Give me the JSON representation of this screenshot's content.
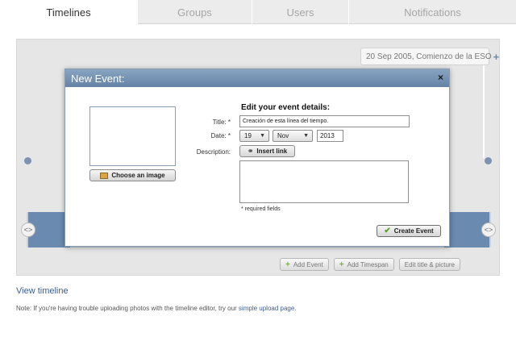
{
  "tabs": [
    {
      "label": "Timelines",
      "active": true
    },
    {
      "label": "Groups",
      "active": false
    },
    {
      "label": "Users",
      "active": false
    },
    {
      "label": "Notifications",
      "active": false
    }
  ],
  "timeline": {
    "event_callout": "20 Sep 2005, Comienzo de la ESO",
    "callout_add_icon": "+",
    "left_arrow": "<>",
    "right_arrow": "<>"
  },
  "editor_actions": {
    "add_event": "Add Event",
    "add_timespan": "Add Timespan",
    "edit_title": "Edit title & picture"
  },
  "modal": {
    "title": "New Event:",
    "close_icon": "×",
    "choose_image_label": "Choose an image",
    "form_heading": "Edit your event details:",
    "title_label": "Title:",
    "date_label": "Date:",
    "description_label": "Description:",
    "required_marker": "*",
    "title_value": "Creación de esta línea del tiempo.",
    "day_value": "19",
    "month_value": "Nov",
    "year_value": "2013",
    "insert_link_label": "Insert link",
    "required_note": "* required fields",
    "create_button_label": "Create Event"
  },
  "footer": {
    "view_timeline": "View timeline",
    "note_prefix": "Note: If you're having trouble uploading photos with the timeline editor, try our ",
    "note_link": "simple upload page",
    "note_suffix": "."
  },
  "colors": {
    "modal_header": "#6f8db0",
    "link": "#3a5f8f",
    "timeline_blue": "#6a8ab0"
  }
}
